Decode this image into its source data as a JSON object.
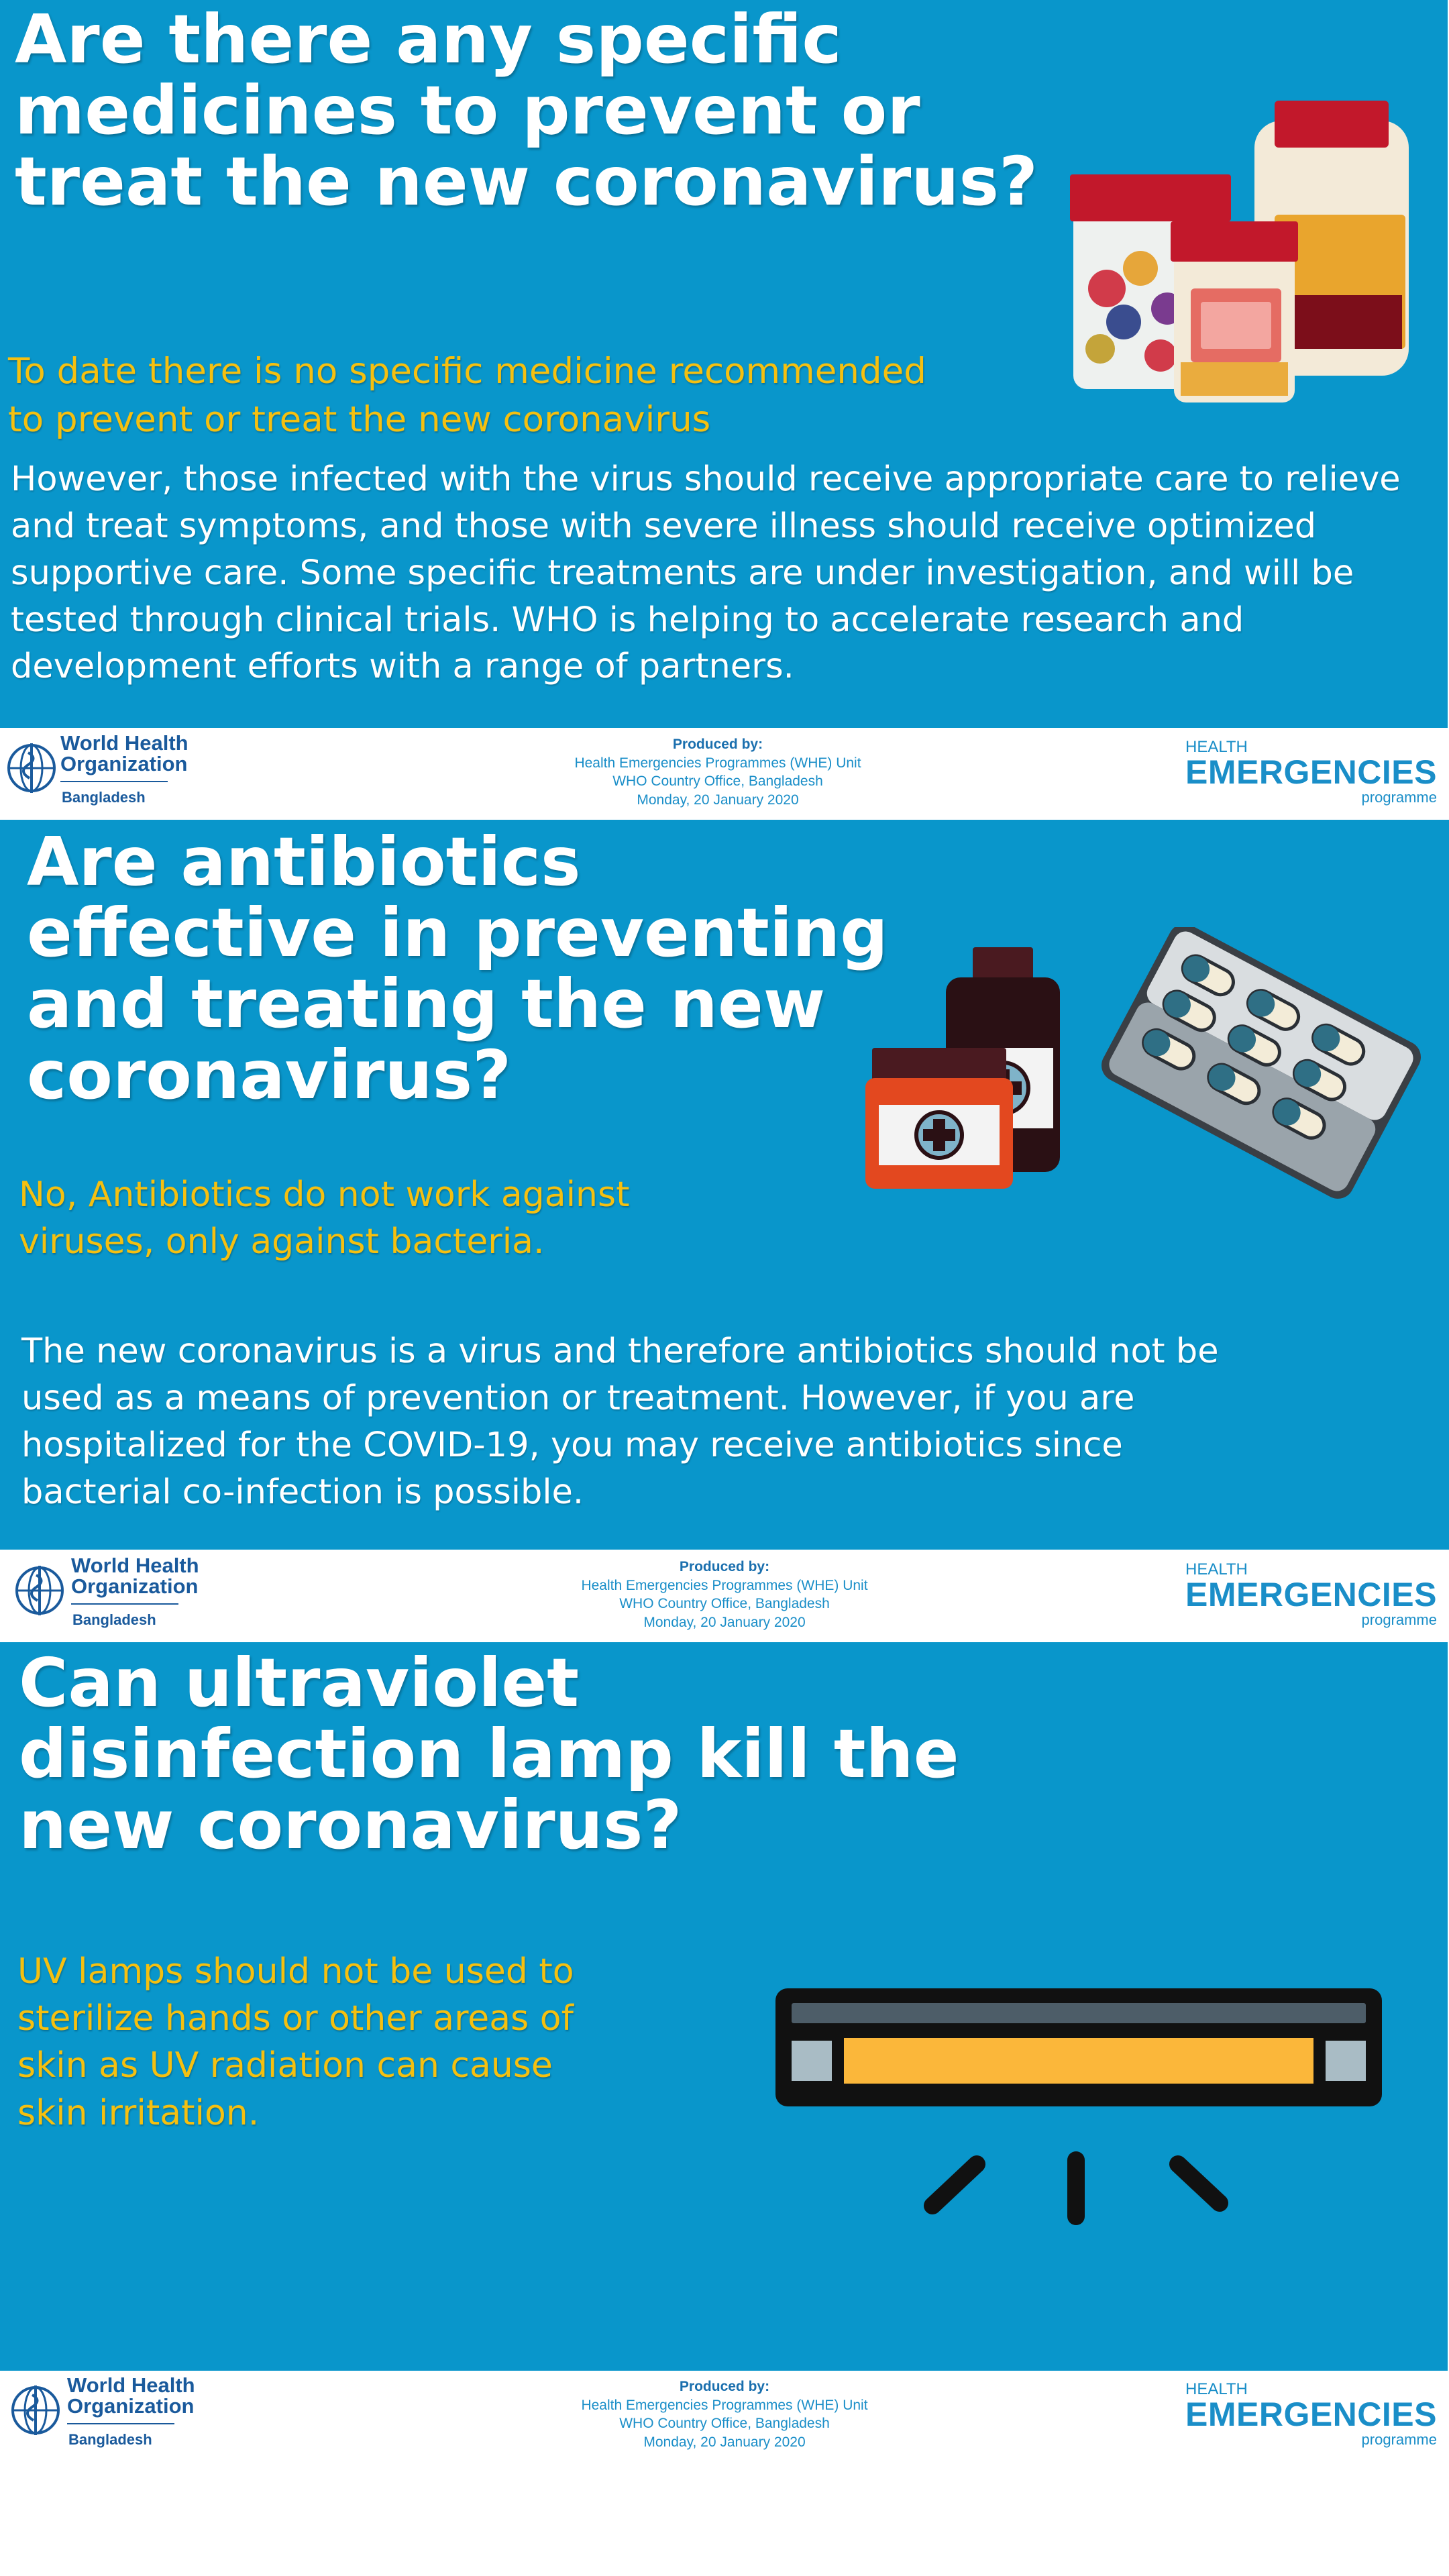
{
  "panels": [
    {
      "title": "Are there any specific medicines to prevent or treat the new coronavirus?",
      "answer": "To date there is no specific medicine recommended to prevent or treat the new coronavirus",
      "body": "However, those infected with the virus should receive appropriate care to relieve and treat symptoms, and those with severe illness should receive optimized supportive care.  Some specific treatments are under investigation, and will be tested through clinical trials. WHO is helping to accelerate research and development efforts with a range of partners.",
      "illustration": "medicine-jars-icon"
    },
    {
      "title": "Are antibiotics effective in preventing and treating the new coronavirus?",
      "answer": "No, Antibiotics do not work against viruses, only against bacteria.",
      "body": "The new coronavirus is a virus and therefore antibiotics should not be used as a means of prevention or treatment. However, if you are hospitalized for the COVID-19, you may receive antibiotics since bacterial co-infection is possible.",
      "illustration": "pill-bottles-and-blister-pack-icon"
    },
    {
      "title": "Can ultraviolet disinfection lamp kill the new coronavirus?",
      "answer": "UV lamps should not be used to sterilize hands or other areas of skin as UV radiation can cause skin irritation.",
      "illustration": "uv-lamp-icon"
    }
  ],
  "footer": {
    "logo_line1": "World Health",
    "logo_line2": "Organization",
    "logo_country": "Bangladesh",
    "produced_by": "Produced by:",
    "unit": "Health Emergencies Programmes (WHE) Unit",
    "office": "WHO Country Office, Bangladesh",
    "date": "Monday, 20 January 2020",
    "he_health": "HEALTH",
    "he_emergencies": "EMERGENCIES",
    "he_programme": "programme"
  },
  "colors": {
    "panel_bg": "#0996cb",
    "answer_text": "#f5c010",
    "who_blue": "#1a5a9c",
    "he_blue": "#1a8ec8"
  }
}
